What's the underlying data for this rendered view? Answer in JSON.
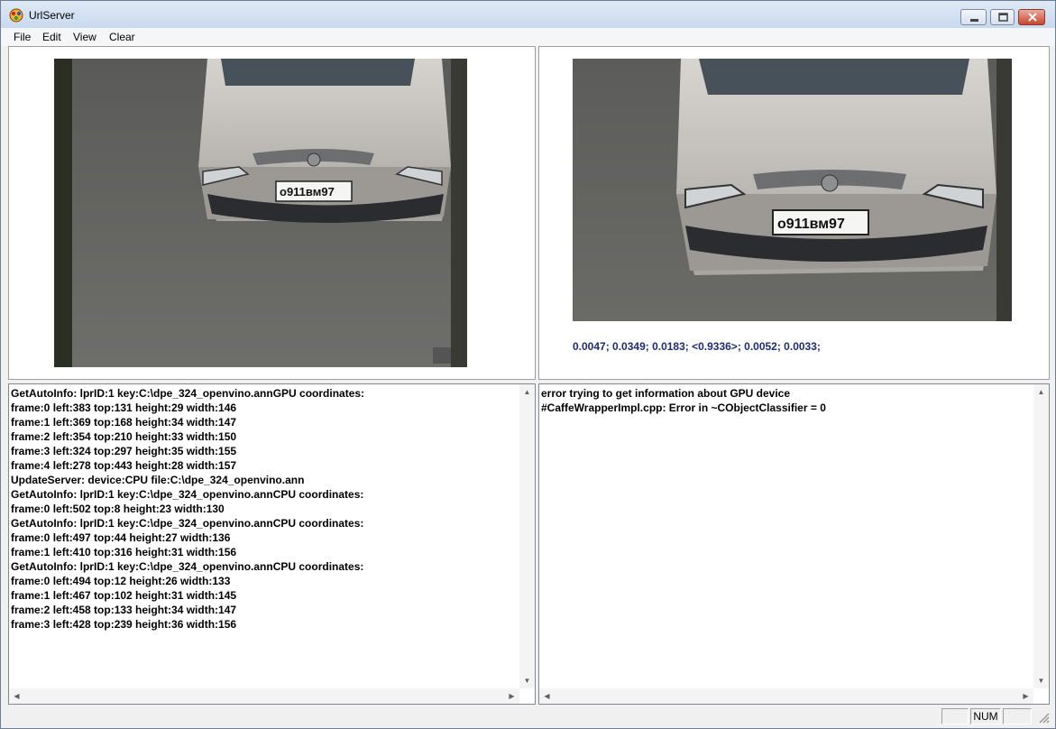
{
  "window": {
    "title": "UrlServer"
  },
  "menu": {
    "file": "File",
    "edit": "Edit",
    "view": "View",
    "clear": "Clear"
  },
  "camera": {
    "left_plate": "о911вм97",
    "right_plate": "о911вм97"
  },
  "scores_text": "0.0047; 0.0349; 0.0183; <0.9336>; 0.0052; 0.0033;",
  "log_left": [
    "GetAutoInfo: lprID:1 key:C:\\dpe_324_openvino.annGPU coordinates:",
    "frame:0 left:383 top:131 height:29 width:146",
    "frame:1 left:369 top:168 height:34 width:147",
    "frame:2 left:354 top:210 height:33 width:150",
    "frame:3 left:324 top:297 height:35 width:155",
    "frame:4 left:278 top:443 height:28 width:157",
    "UpdateServer: device:CPU file:C:\\dpe_324_openvino.ann",
    "GetAutoInfo: lprID:1 key:C:\\dpe_324_openvino.annCPU coordinates:",
    "frame:0 left:502 top:8 height:23 width:130",
    "GetAutoInfo: lprID:1 key:C:\\dpe_324_openvino.annCPU coordinates:",
    "frame:0 left:497 top:44 height:27 width:136",
    "frame:1 left:410 top:316 height:31 width:156",
    "GetAutoInfo: lprID:1 key:C:\\dpe_324_openvino.annCPU coordinates:",
    "frame:0 left:494 top:12 height:26 width:133",
    "frame:1 left:467 top:102 height:31 width:145",
    "frame:2 left:458 top:133 height:34 width:147",
    "frame:3 left:428 top:239 height:36 width:156"
  ],
  "log_right": [
    "error trying to get information about GPU device",
    "#CaffeWrapperImpl.cpp: Error in ~CObjectClassifier = 0"
  ],
  "status": {
    "num": "NUM"
  }
}
